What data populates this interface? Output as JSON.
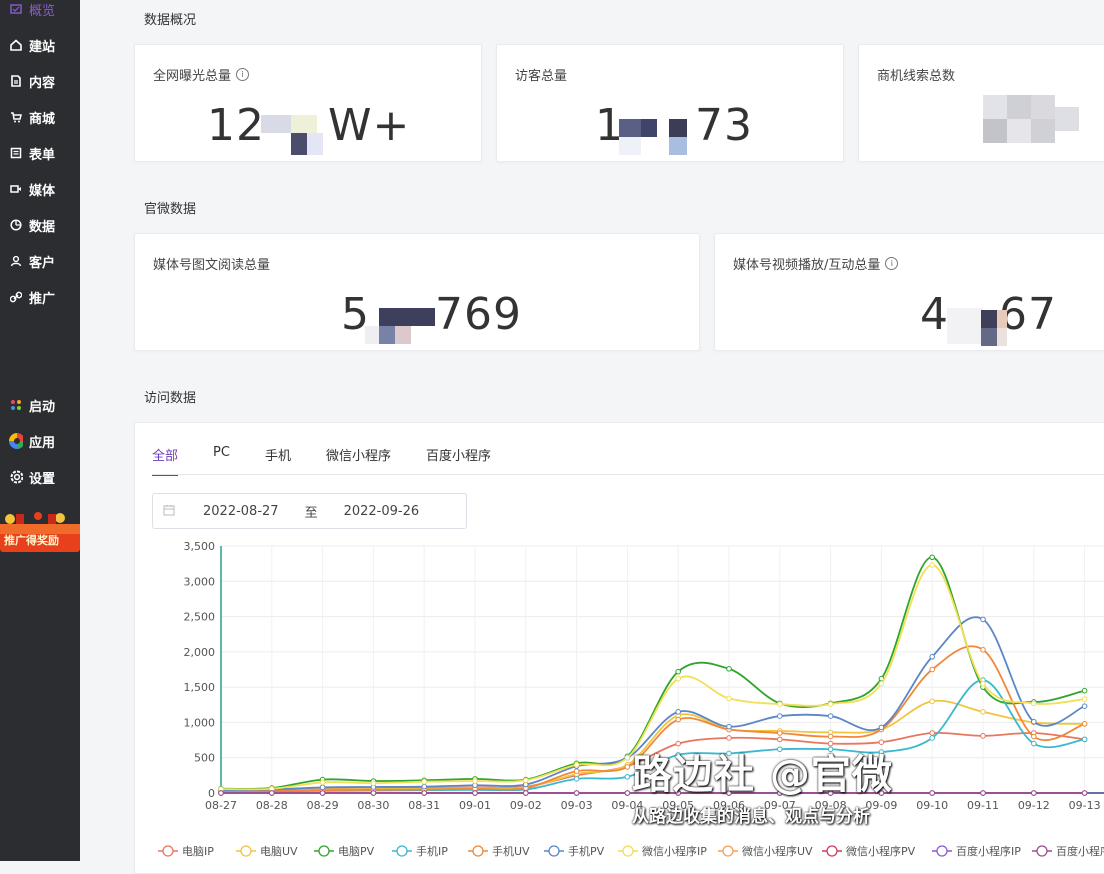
{
  "sidebar": {
    "items": [
      {
        "label": "概览",
        "icon": "overview-icon",
        "active": true
      },
      {
        "label": "建站",
        "icon": "home-icon"
      },
      {
        "label": "内容",
        "icon": "document-icon"
      },
      {
        "label": "商城",
        "icon": "cart-icon"
      },
      {
        "label": "表单",
        "icon": "form-icon"
      },
      {
        "label": "媒体",
        "icon": "video-icon"
      },
      {
        "label": "数据",
        "icon": "chart-pie-icon"
      },
      {
        "label": "客户",
        "icon": "user-icon"
      },
      {
        "label": "推广",
        "icon": "link-icon"
      }
    ],
    "bottom_items": [
      {
        "label": "启动",
        "icon": "launch-dots-icon"
      },
      {
        "label": "应用",
        "icon": "apps-color-icon"
      },
      {
        "label": "设置",
        "icon": "gear-icon"
      }
    ],
    "promo_label": "推广得奖励"
  },
  "overview": {
    "title": "数据概况",
    "cards": [
      {
        "label": "全网曝光总量",
        "value_prefix": "12",
        "value_suffix": "W+"
      },
      {
        "label": "访客总量",
        "value_prefix": "1",
        "value_suffix": "73"
      },
      {
        "label": "商机线索总数",
        "value_prefix": "",
        "value_suffix": ""
      }
    ]
  },
  "official": {
    "title": "官微数据",
    "cards": [
      {
        "label": "媒体号图文阅读总量",
        "value_prefix": "5",
        "value_suffix": "769"
      },
      {
        "label": "媒体号视频播放/互动总量",
        "value_prefix": "4",
        "value_suffix": "67"
      }
    ]
  },
  "visits": {
    "title": "访问数据",
    "tabs": [
      "全部",
      "PC",
      "手机",
      "微信小程序",
      "百度小程序"
    ],
    "date_start": "2022-08-27",
    "date_sep": "至",
    "date_end": "2022-09-26"
  },
  "chart_data": {
    "type": "line",
    "x": [
      "08-27",
      "08-28",
      "08-29",
      "08-30",
      "08-31",
      "09-01",
      "09-02",
      "09-03",
      "09-04",
      "09-05",
      "09-06",
      "09-07",
      "09-08",
      "09-09",
      "09-10",
      "09-11",
      "09-12",
      "09-13"
    ],
    "ylim": [
      0,
      3500
    ],
    "yticks": [
      "0",
      "500",
      "1,000",
      "1,500",
      "2,000",
      "2,500",
      "3,000",
      "3,500"
    ],
    "grid": true,
    "legend_position": "bottom",
    "series": [
      {
        "name": "电脑IP",
        "color": "#e8765d",
        "values": [
          40,
          45,
          60,
          60,
          70,
          80,
          90,
          250,
          380,
          700,
          780,
          760,
          700,
          720,
          850,
          810,
          850,
          760
        ]
      },
      {
        "name": "电脑UV",
        "color": "#f0c541",
        "values": [
          30,
          35,
          50,
          55,
          60,
          70,
          80,
          270,
          400,
          1100,
          900,
          880,
          860,
          900,
          1300,
          1150,
          1000,
          980
        ]
      },
      {
        "name": "电脑PV",
        "color": "#2fa52b",
        "values": [
          60,
          70,
          190,
          170,
          180,
          200,
          190,
          420,
          520,
          1720,
          1760,
          1270,
          1270,
          1620,
          3340,
          1500,
          1290,
          1450
        ]
      },
      {
        "name": "手机IP",
        "color": "#3bb8d0",
        "values": [
          20,
          25,
          30,
          35,
          40,
          45,
          50,
          200,
          230,
          540,
          560,
          620,
          620,
          580,
          780,
          1600,
          700,
          760
        ]
      },
      {
        "name": "手机UV",
        "color": "#f0883a",
        "values": [
          30,
          35,
          40,
          45,
          50,
          60,
          70,
          310,
          370,
          1040,
          900,
          850,
          800,
          900,
          1750,
          2030,
          800,
          980
        ]
      },
      {
        "name": "手机PV",
        "color": "#5b86c7",
        "values": [
          40,
          50,
          80,
          85,
          90,
          110,
          120,
          380,
          500,
          1150,
          940,
          1090,
          1090,
          930,
          1930,
          2460,
          1010,
          1230
        ]
      },
      {
        "name": "微信小程序IP",
        "color": "#f3de57",
        "values": [
          55,
          60,
          150,
          140,
          160,
          170,
          180,
          400,
          500,
          1620,
          1340,
          1260,
          1260,
          1550,
          3230,
          1550,
          1270,
          1330
        ]
      },
      {
        "name": "微信小程序UV",
        "color": "#f2a15a",
        "values": [
          0,
          0,
          0,
          0,
          0,
          0,
          0,
          0,
          0,
          0,
          0,
          0,
          0,
          0,
          0,
          0,
          0,
          0
        ]
      },
      {
        "name": "微信小程序PV",
        "color": "#c93d5c",
        "values": [
          0,
          0,
          0,
          0,
          0,
          0,
          0,
          0,
          0,
          0,
          0,
          0,
          0,
          0,
          0,
          0,
          0,
          0
        ]
      },
      {
        "name": "百度小程序IP",
        "color": "#8a5cd1",
        "values": [
          0,
          0,
          0,
          0,
          0,
          0,
          0,
          0,
          0,
          0,
          0,
          0,
          0,
          0,
          0,
          0,
          0,
          0
        ]
      },
      {
        "name": "百度小程序PV",
        "color": "#9b4f8f",
        "values": [
          0,
          0,
          0,
          0,
          0,
          0,
          0,
          0,
          0,
          0,
          0,
          0,
          0,
          0,
          0,
          0,
          0,
          0
        ]
      }
    ]
  },
  "watermark": {
    "title": "路边社 @官微",
    "subtitle": "从路边收集的消息、观点与分析"
  }
}
